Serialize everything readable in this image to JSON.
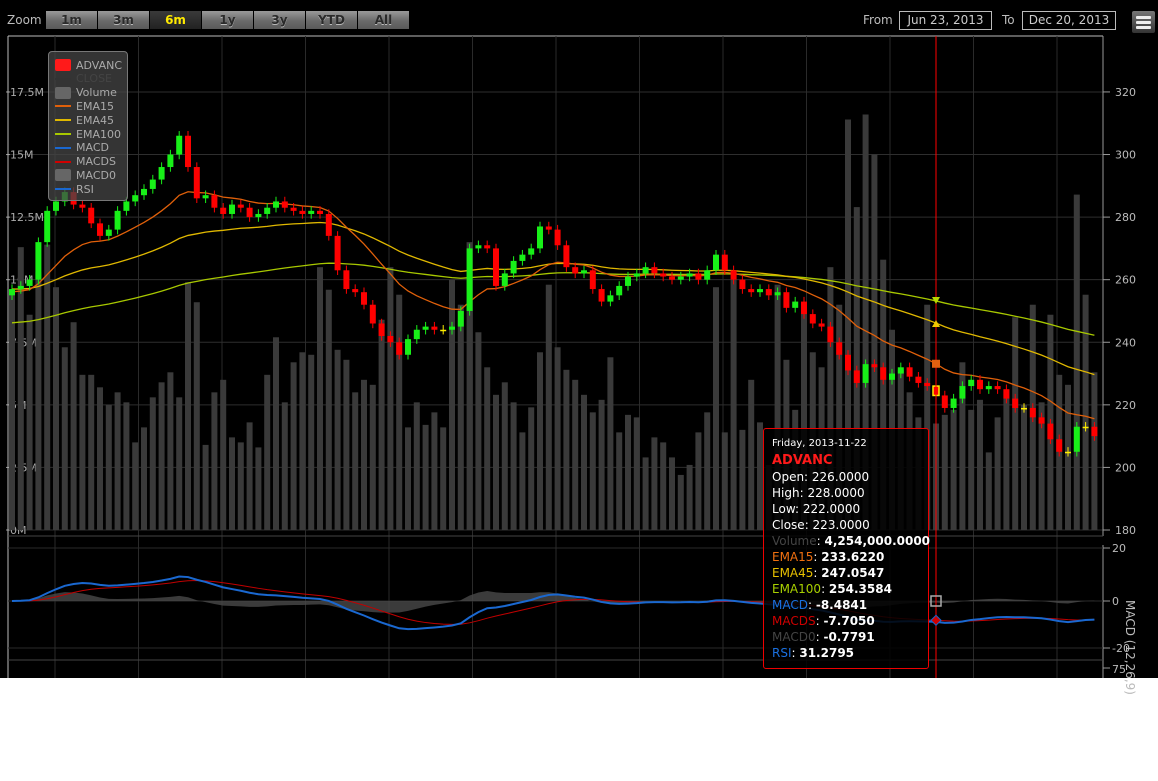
{
  "toolbar": {
    "zoom_label": "Zoom",
    "zoom_buttons": [
      "1m",
      "3m",
      "6m",
      "1y",
      "3y",
      "YTD",
      "All"
    ],
    "selected_zoom": "6m",
    "from_label": "From",
    "from_value": "Jun 23, 2013",
    "to_label": "To",
    "to_value": "Dec 20, 2013",
    "menu_icon": "hamburger-menu-icon"
  },
  "legend": [
    {
      "label": "ADVANC",
      "color": "#ff1a1a",
      "kind": "rect"
    },
    {
      "label": "CLOSE",
      "color": "#333333",
      "kind": "line",
      "dimmed": true
    },
    {
      "label": "Volume",
      "color": "#666666",
      "kind": "rect"
    },
    {
      "label": "EMA15",
      "color": "#e0600a",
      "kind": "line"
    },
    {
      "label": "EMA45",
      "color": "#e0b800",
      "kind": "line"
    },
    {
      "label": "EMA100",
      "color": "#a8c800",
      "kind": "line"
    },
    {
      "label": "MACD",
      "color": "#1a68d0",
      "kind": "line"
    },
    {
      "label": "MACDS",
      "color": "#d00000",
      "kind": "line"
    },
    {
      "label": "MACD0",
      "color": "#666666",
      "kind": "rect"
    },
    {
      "label": "RSI",
      "color": "#1a68d0",
      "kind": "line"
    }
  ],
  "tooltip": {
    "date": "Friday, 2013-11-22",
    "series": "ADVANC",
    "open": "Open: 226.0000",
    "high": "High: 228.0000",
    "low": "Low: 222.0000",
    "close": "Close: 223.0000",
    "volume_label": "Volume",
    "volume_value": "4,254,000.0000",
    "ema15_label": "EMA15",
    "ema15_value": "233.6220",
    "ema45_label": "EMA45",
    "ema45_value": "247.0547",
    "ema100_label": "EMA100",
    "ema100_value": "254.3584",
    "macd_label": "MACD",
    "macd_value": "-8.4841",
    "macds_label": "MACDS",
    "macds_value": "-7.7050",
    "macd0_label": "MACD0",
    "macd0_value": "-0.7791",
    "rsi_label": "RSI",
    "rsi_value": "31.2795"
  },
  "chart_data": {
    "type": "candlestick",
    "series_name": "ADVANC",
    "selected_index": 105,
    "price_axis": {
      "ticks": [
        180,
        200,
        220,
        240,
        260,
        280,
        300,
        320
      ],
      "range": [
        180,
        320
      ]
    },
    "volume_axis": {
      "ticks": [
        "0M",
        "2.5M",
        "5M",
        "7.5M",
        "10M",
        "12.5M",
        "15M",
        "17.5M"
      ],
      "range": [
        0,
        17.5
      ]
    },
    "macd_axis": {
      "title": "MACD (12,26,9)",
      "ticks": [
        "20",
        "0",
        "-20"
      ],
      "range": [
        -20,
        20
      ]
    },
    "rsi_axis": {
      "ticks": [
        "75"
      ]
    },
    "colors": {
      "up": "#18f018",
      "down": "#ff0000",
      "doji": "#ffee00",
      "volume": "#3a3a3a",
      "ema15": "#e0600a",
      "ema45": "#e0b800",
      "ema100": "#a8c800",
      "macd": "#1a68d0",
      "macds": "#c00000",
      "macd0": "#4a4a4a",
      "crosshair": "#ff0000"
    },
    "ema_seeds": {
      "ema15": 256,
      "ema45": 257,
      "ema100": 246
    },
    "open": [
      255,
      257,
      258,
      260,
      272,
      282,
      285,
      288,
      284,
      283,
      278,
      274,
      276,
      282,
      285,
      287,
      289,
      292,
      296,
      300,
      306,
      296,
      286,
      287,
      283,
      281,
      284,
      283,
      280,
      281,
      283,
      285,
      283,
      282,
      281,
      282,
      281,
      274,
      263,
      257,
      256,
      252,
      246,
      242,
      240,
      236,
      241,
      244,
      245,
      244,
      244,
      245,
      250,
      270,
      271,
      270,
      258,
      262,
      266,
      268,
      270,
      277,
      276,
      271,
      264,
      262,
      263,
      257,
      253,
      255,
      258,
      261,
      262,
      264,
      262,
      261,
      260,
      261,
      262,
      260,
      263,
      268,
      263,
      260,
      257,
      256,
      257,
      255,
      256,
      251,
      253,
      249,
      246,
      245,
      240,
      236,
      231,
      227,
      233,
      232,
      228,
      230,
      232,
      229,
      227,
      226,
      223,
      219,
      222,
      226,
      228,
      225,
      226,
      225,
      222,
      219,
      219,
      216,
      214,
      209,
      205,
      205,
      213,
      213
    ],
    "close": [
      257,
      258,
      260,
      272,
      282,
      285,
      288,
      284,
      283,
      278,
      274,
      276,
      282,
      285,
      287,
      289,
      292,
      296,
      300,
      306,
      296,
      286,
      287,
      283,
      281,
      284,
      283,
      280,
      281,
      283,
      285,
      283,
      282,
      281,
      282,
      281,
      274,
      263,
      257,
      256,
      252,
      246,
      242,
      240,
      236,
      241,
      244,
      245,
      244,
      244,
      245,
      250,
      270,
      271,
      270,
      258,
      262,
      266,
      268,
      270,
      277,
      276,
      271,
      264,
      262,
      263,
      257,
      253,
      255,
      258,
      261,
      262,
      264,
      262,
      261,
      260,
      261,
      262,
      260,
      263,
      268,
      263,
      260,
      257,
      256,
      257,
      255,
      256,
      251,
      253,
      249,
      246,
      245,
      240,
      236,
      231,
      227,
      233,
      232,
      228,
      230,
      232,
      229,
      227,
      226,
      223,
      219,
      222,
      226,
      228,
      225,
      226,
      225,
      222,
      219,
      219,
      216,
      214,
      209,
      205,
      205,
      213,
      213,
      210
    ],
    "volume_millions": [
      9.5,
      11.3,
      8.6,
      10.3,
      11.4,
      9.7,
      7.3,
      8.3,
      6.2,
      6.2,
      5.7,
      5.0,
      5.5,
      5.1,
      3.5,
      4.1,
      5.3,
      5.9,
      6.3,
      5.3,
      9.9,
      9.1,
      3.4,
      5.5,
      6.0,
      3.7,
      3.5,
      4.3,
      3.3,
      6.2,
      7.7,
      5.1,
      6.7,
      7.1,
      7.0,
      10.5,
      9.6,
      7.2,
      6.8,
      5.5,
      6.0,
      5.8,
      8.4,
      10.5,
      9.4,
      4.1,
      5.1,
      4.2,
      4.7,
      4.1,
      10.0,
      9.0,
      11.5,
      7.9,
      6.5,
      5.4,
      5.9,
      5.1,
      3.9,
      4.9,
      7.1,
      9.8,
      7.3,
      6.4,
      6.0,
      5.4,
      4.7,
      5.2,
      6.9,
      3.9,
      4.6,
      4.5,
      2.9,
      3.7,
      3.5,
      2.9,
      2.2,
      2.6,
      3.9,
      4.7,
      9.7,
      3.9,
      10.0,
      4.0,
      6.0,
      4.3,
      2.6,
      9.8,
      6.8,
      4.8,
      8.7,
      7.1,
      6.5,
      10.5,
      9.0,
      16.4,
      12.9,
      16.6,
      15.0,
      10.8,
      8.0,
      6.4,
      5.5,
      4.5,
      9.0,
      4.254,
      4.6,
      4.8,
      6.7,
      4.8,
      5.2,
      3.1,
      4.5,
      5.6,
      8.5,
      5.0,
      9.0,
      5.1,
      8.6,
      6.2,
      5.8,
      13.4,
      9.4,
      6.3
    ]
  }
}
